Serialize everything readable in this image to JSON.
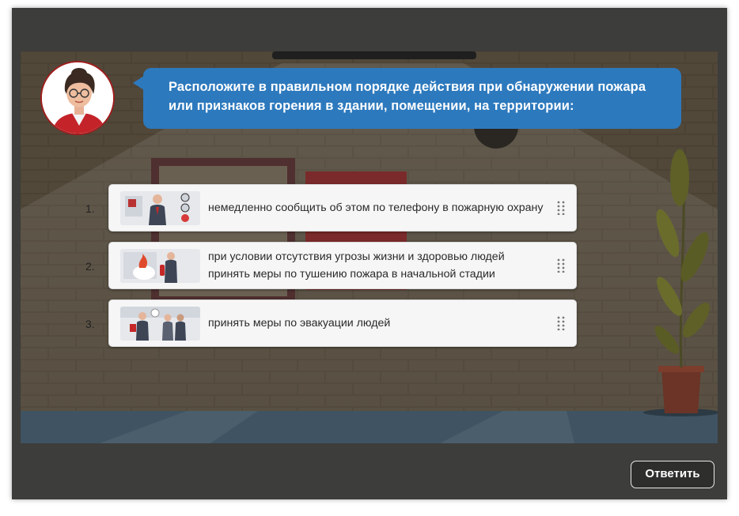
{
  "question": {
    "text": "Расположите в правильном порядке действия при обнаружении пожара или признаков горения в здании, помещении, на территории:"
  },
  "items": [
    {
      "number": "1.",
      "text": "немедленно сообщить об этом по телефону в пожарную охрану",
      "icon": "phone-call-illustration"
    },
    {
      "number": "2.",
      "text": "при условии отсутствия угрозы жизни и здоровью людей принять меры по тушению пожара в начальной стадии",
      "icon": "fire-extinguisher-illustration"
    },
    {
      "number": "3.",
      "text": "принять меры по эвакуации людей",
      "icon": "evacuation-illustration"
    }
  ],
  "footer": {
    "submit_label": "Ответить"
  },
  "colors": {
    "bubble": "#2d79bd",
    "frame": "#3d3d3b",
    "avatar_border": "#a01d1d"
  }
}
